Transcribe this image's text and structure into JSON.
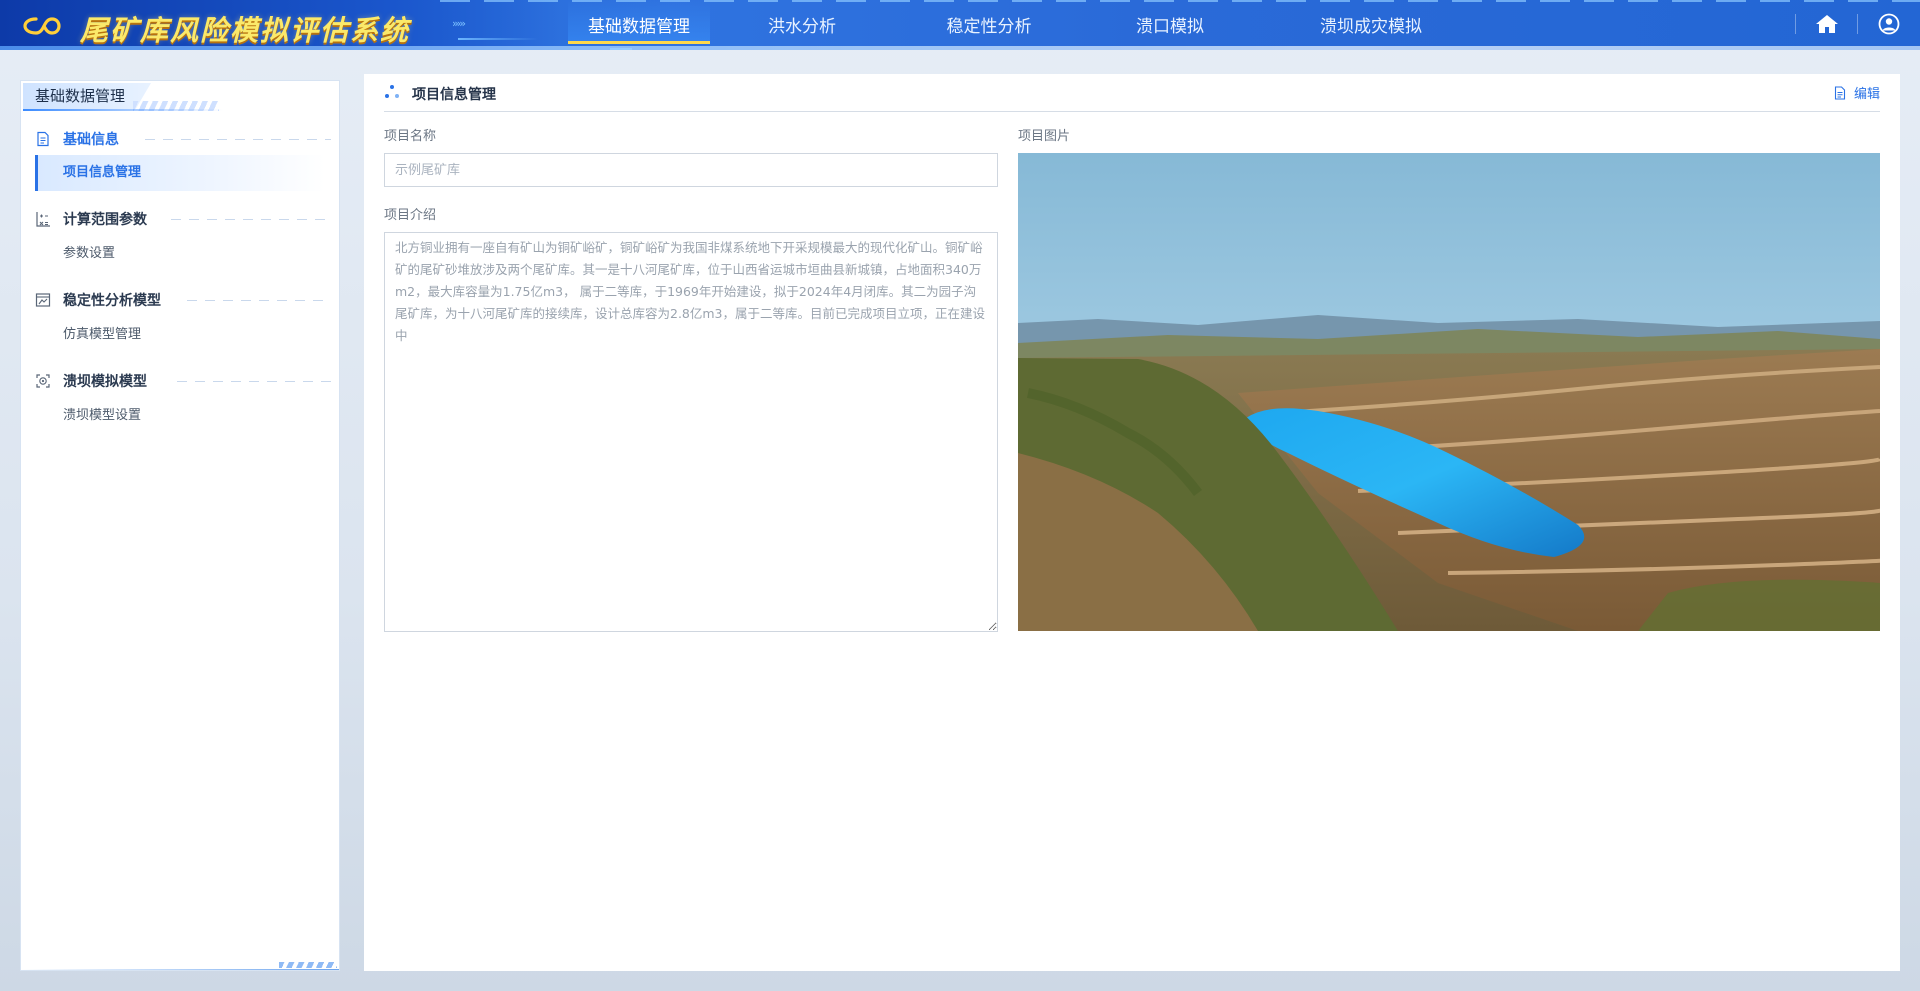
{
  "header": {
    "title": "尾矿库风险模拟评估系统",
    "nav": [
      {
        "label": "基础数据管理",
        "active": true
      },
      {
        "label": "洪水分析",
        "active": false
      },
      {
        "label": "稳定性分析",
        "active": false
      },
      {
        "label": "溃口模拟",
        "active": false
      },
      {
        "label": "溃坝成灾模拟",
        "active": false
      }
    ],
    "icons": [
      "home-icon",
      "user-icon"
    ],
    "accent_color": "#ffd84a",
    "brand_color": "#2366d4"
  },
  "sidebar": {
    "title": "基础数据管理",
    "groups": [
      {
        "label": "基础信息",
        "icon": "document-icon",
        "active": true,
        "items": [
          {
            "label": "项目信息管理",
            "active": true
          }
        ]
      },
      {
        "label": "计算范围参数",
        "icon": "calculator-icon",
        "active": false,
        "items": [
          {
            "label": "参数设置",
            "active": false
          }
        ]
      },
      {
        "label": "稳定性分析模型",
        "icon": "analysis-model-icon",
        "active": false,
        "items": [
          {
            "label": "仿真模型管理",
            "active": false
          }
        ]
      },
      {
        "label": "溃坝模拟模型",
        "icon": "dam-break-model-icon",
        "active": false,
        "items": [
          {
            "label": "溃坝模型设置",
            "active": false
          }
        ]
      }
    ]
  },
  "main": {
    "title": "项目信息管理",
    "edit_label": "编辑",
    "form": {
      "name_label": "项目名称",
      "name_placeholder": "示例尾矿库",
      "intro_label": "项目介绍",
      "intro_text": "北方铜业拥有一座自有矿山为铜矿峪矿，铜矿峪矿为我国非煤系统地下开采规模最大的现代化矿山。铜矿峪矿的尾矿砂堆放涉及两个尾矿库。其一是十八河尾矿库，位于山西省运城市垣曲县新城镇，占地面积340万m2，最大库容量为1.75亿m3， 属于二等库，于1969年开始建设，拟于2024年4月闭库。其二为园子沟尾矿库，为十八河尾矿库的接续库，设计总库容为2.8亿m3，属于二等库。目前已完成项目立项，正在建设中",
      "image_label": "项目图片"
    }
  }
}
